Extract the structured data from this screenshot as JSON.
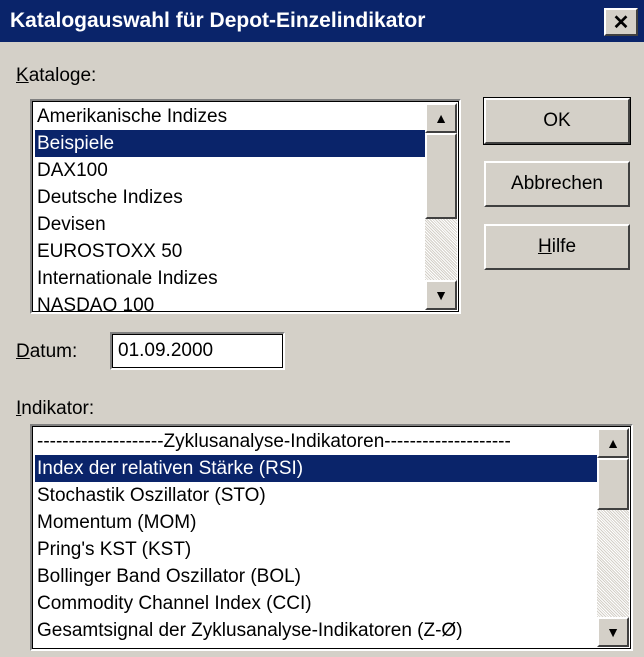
{
  "window": {
    "title": "Katalogauswahl für Depot-Einzelindikator",
    "close_glyph": "✕"
  },
  "kataloge": {
    "label": "Kataloge:",
    "items": [
      {
        "label": "Amerikanische Indizes",
        "selected": false
      },
      {
        "label": "Beispiele",
        "selected": true
      },
      {
        "label": "DAX100",
        "selected": false
      },
      {
        "label": "Deutsche Indizes",
        "selected": false
      },
      {
        "label": "Devisen",
        "selected": false
      },
      {
        "label": "EUROSTOXX 50",
        "selected": false
      },
      {
        "label": "Internationale Indizes",
        "selected": false
      },
      {
        "label": "NASDAQ 100",
        "selected": false
      }
    ]
  },
  "buttons": {
    "ok": "OK",
    "cancel": "Abbrechen",
    "help": "Hilfe"
  },
  "datum": {
    "label": "Datum:",
    "value": "01.09.2000"
  },
  "indikator": {
    "label": "Indikator:",
    "items": [
      {
        "label": "--------------------Zyklusanalyse-Indikatoren--------------------",
        "selected": false
      },
      {
        "label": "Index der relativen Stärke (RSI)",
        "selected": true
      },
      {
        "label": "Stochastik Oszillator (STO)",
        "selected": false
      },
      {
        "label": "Momentum (MOM)",
        "selected": false
      },
      {
        "label": "Pring's KST (KST)",
        "selected": false
      },
      {
        "label": "Bollinger Band Oszillator (BOL)",
        "selected": false
      },
      {
        "label": "Commodity Channel Index (CCI)",
        "selected": false
      },
      {
        "label": "Gesamtsignal der Zyklusanalyse-Indikatoren (Z-Ø)",
        "selected": false
      }
    ]
  },
  "icons": {
    "scroll_up": "▲",
    "scroll_down": "▼"
  },
  "colors": {
    "titlebar": "#0a246a",
    "face": "#d4d0c8",
    "selection": "#0a246a"
  }
}
